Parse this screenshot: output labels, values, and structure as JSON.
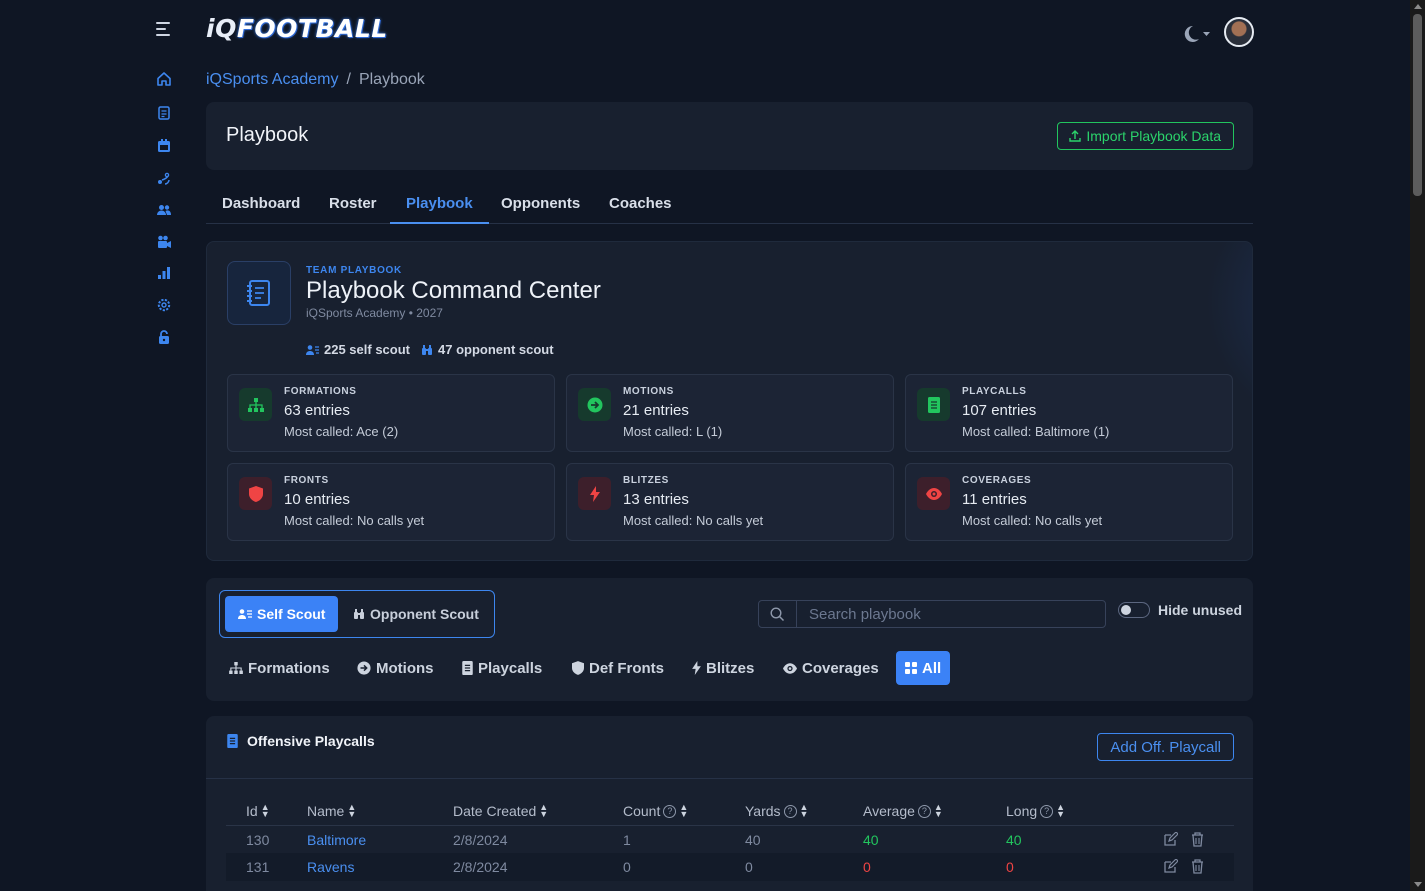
{
  "app": {
    "logo_iq": "iQ",
    "logo_fb": "FOOTBALL"
  },
  "breadcrumb": {
    "parent": "iQSports Academy",
    "current": "Playbook"
  },
  "header": {
    "title": "Playbook",
    "import_label": "Import Playbook Data"
  },
  "tabs": [
    {
      "label": "Dashboard"
    },
    {
      "label": "Roster"
    },
    {
      "label": "Playbook",
      "active": true
    },
    {
      "label": "Opponents"
    },
    {
      "label": "Coaches"
    }
  ],
  "command": {
    "eyebrow": "TEAM PLAYBOOK",
    "title": "Playbook Command Center",
    "subtitle": "iQSports Academy • 2027",
    "self_scout": "225 self scout",
    "opponent_scout": "47 opponent scout"
  },
  "cards": [
    {
      "label": "FORMATIONS",
      "count": "63 entries",
      "most": "Most called: Ace (2)",
      "icon": "sitemap-icon",
      "tone": "green"
    },
    {
      "label": "MOTIONS",
      "count": "21 entries",
      "most": "Most called: L (1)",
      "icon": "arrow-circle-icon",
      "tone": "green"
    },
    {
      "label": "PLAYCALLS",
      "count": "107 entries",
      "most": "Most called: Baltimore (1)",
      "icon": "document-icon",
      "tone": "green"
    },
    {
      "label": "FRONTS",
      "count": "10 entries",
      "most": "Most called: No calls yet",
      "icon": "shield-icon",
      "tone": "red"
    },
    {
      "label": "BLITZES",
      "count": "13 entries",
      "most": "Most called: No calls yet",
      "icon": "bolt-icon",
      "tone": "red"
    },
    {
      "label": "COVERAGES",
      "count": "11 entries",
      "most": "Most called: No calls yet",
      "icon": "eye-icon",
      "tone": "red"
    }
  ],
  "filters": {
    "self_scout": "Self Scout",
    "opponent_scout": "Opponent Scout",
    "search_placeholder": "Search playbook",
    "hide_unused": "Hide unused",
    "categories": [
      "Formations",
      "Motions",
      "Playcalls",
      "Def Fronts",
      "Blitzes",
      "Coverages",
      "All"
    ],
    "active_category": "All"
  },
  "table": {
    "title": "Offensive Playcalls",
    "add_label": "Add Off. Playcall",
    "columns": [
      "Id",
      "Name",
      "Date Created",
      "Count",
      "Yards",
      "Average",
      "Long"
    ],
    "rows": [
      {
        "id": "130",
        "name": "Baltimore",
        "date": "2/8/2024",
        "count": "1",
        "yards": "40",
        "average": "40",
        "long": "40"
      },
      {
        "id": "131",
        "name": "Ravens",
        "date": "2/8/2024",
        "count": "0",
        "yards": "0",
        "average": "0",
        "long": "0"
      }
    ]
  },
  "colors": {
    "accent": "#3b82f6",
    "success": "#22c55e",
    "danger": "#ef4444",
    "background": "#0f1624",
    "panel": "#18202f"
  }
}
